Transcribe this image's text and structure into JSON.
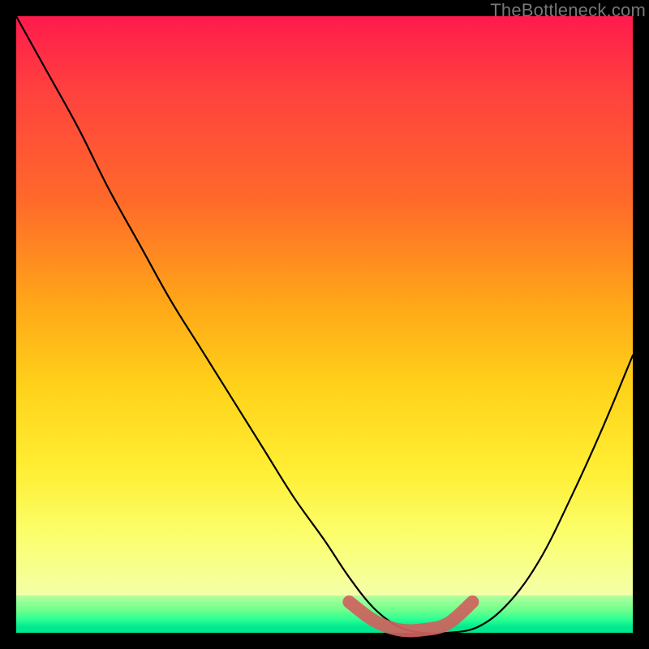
{
  "watermark": {
    "text": "TheBottleneck.com"
  },
  "chart_data": {
    "type": "line",
    "title": "",
    "xlabel": "",
    "ylabel": "",
    "xlim": [
      0,
      100
    ],
    "ylim": [
      0,
      100
    ],
    "series": [
      {
        "name": "bottleneck-curve",
        "x": [
          0,
          5,
          10,
          15,
          20,
          25,
          30,
          35,
          40,
          45,
          50,
          54,
          58,
          62,
          66,
          70,
          75,
          80,
          85,
          90,
          95,
          100
        ],
        "y": [
          100,
          91,
          82,
          72,
          63,
          54,
          46,
          38,
          30,
          22,
          15,
          9,
          4,
          1,
          0,
          0,
          1,
          5,
          12,
          22,
          33,
          45
        ]
      },
      {
        "name": "sweet-spot-band",
        "x": [
          54,
          58,
          62,
          66,
          70,
          74
        ],
        "y": [
          5,
          2,
          0.5,
          0.5,
          1.5,
          5
        ]
      }
    ],
    "colors": {
      "curve": "#000000",
      "sweet_spot": "#d0615e",
      "gradient_top": "#ff1a4d",
      "gradient_mid": "#ffd21a",
      "gradient_bottom": "#00e98e"
    }
  }
}
